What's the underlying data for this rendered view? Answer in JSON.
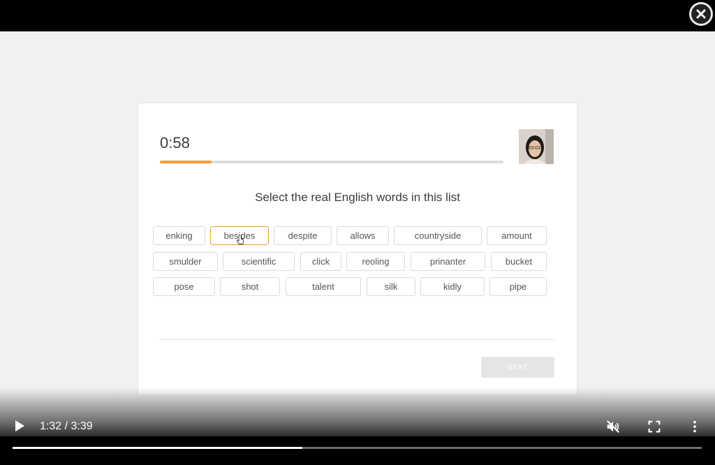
{
  "quiz": {
    "timer": "0:58",
    "progress_fraction": 0.15,
    "prompt": "Select the real English words in this list",
    "selected_word": "besides",
    "words": [
      [
        "enking",
        "besides",
        "despite",
        "allows",
        "countryside",
        "amount"
      ],
      [
        "smulder",
        "scientific",
        "click",
        "reoling",
        "prinanter",
        "bucket"
      ],
      [
        "pose",
        "shot",
        "talent",
        "silk",
        "kidly",
        "pipe"
      ]
    ],
    "next_label": "NEXT"
  },
  "player": {
    "current_time": "1:32",
    "separator": " / ",
    "duration": "3:39",
    "played_fraction": 0.42,
    "muted": true
  },
  "icons": {
    "close": "close-icon",
    "play": "play-icon",
    "mute": "volume-muted-icon",
    "fullscreen": "fullscreen-icon",
    "more": "more-vert-icon"
  },
  "colors": {
    "accent": "#f49b38",
    "page_bg": "#f1f1f1"
  }
}
